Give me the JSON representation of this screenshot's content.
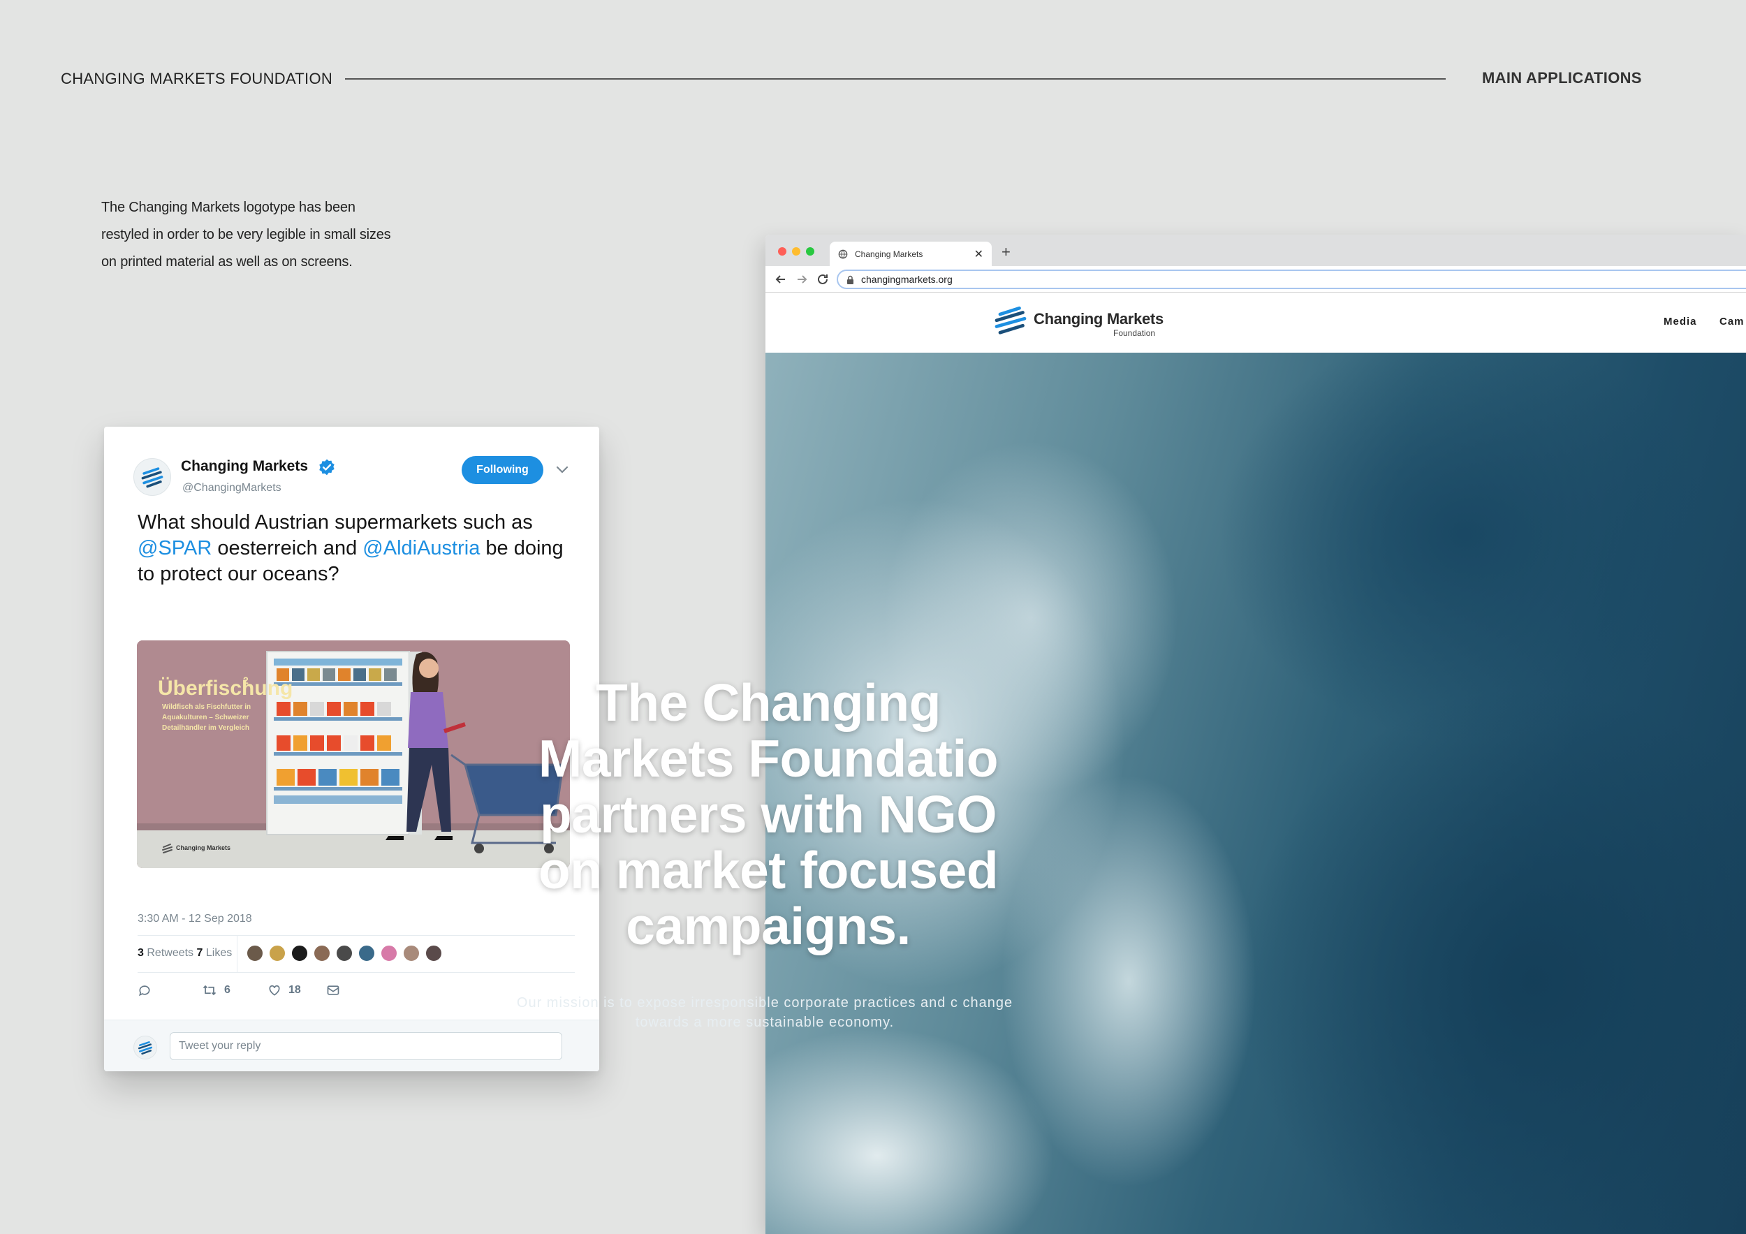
{
  "header": {
    "left_title": "CHANGING MARKETS FOUNDATION",
    "right_title": "MAIN APPLICATIONS"
  },
  "intro": {
    "text": "The Changing Markets logotype has been restyled in order to be very legible in small sizes on printed material as well as on screens."
  },
  "tweet": {
    "name": "Changing Markets",
    "handle": "@ChangingMarkets",
    "follow_label": "Following",
    "text_part1": "What should Austrian supermarkets such as ",
    "mention1": "@SPAR",
    "text_part2": " oesterreich and ",
    "mention2": "@AldiAustria",
    "text_part3": " be doing to protect our oceans?",
    "media": {
      "headline": "Überfischung",
      "superscript": "2",
      "sub": "Wildfisch als Fischfutter in Aquakulturen – Schweizer Detailhändler im Vergleich",
      "brand": "Changing Markets"
    },
    "timestamp": "3:30 AM - 12 Sep 2018",
    "retweets_count": "3",
    "retweets_label": "Retweets",
    "likes_count": "7",
    "likes_label": "Likes",
    "liker_colors": [
      "#6b5a4a",
      "#c9a24a",
      "#1b1b1b",
      "#8a6a55",
      "#4a4a4a",
      "#3a6a8a",
      "#d77aa8",
      "#a88a7a",
      "#5a4a4a"
    ],
    "action_retweets": "6",
    "action_likes": "18",
    "reply_placeholder": "Tweet your reply"
  },
  "browser": {
    "tab_title": "Changing Markets",
    "url": "changingmarkets.org",
    "site_brand": "Changing Markets",
    "site_brand_sub": "Foundation",
    "nav_media": "Media",
    "nav_cam": "Cam",
    "hero_title": "The Changing Markets Foundatio partners with NGO on market focused campaigns.",
    "hero_sub": "Our mission is to expose irresponsible corporate practices and c change towards a more sustainable economy."
  },
  "colors": {
    "background": "#e3e4e3",
    "twitter_blue": "#1d8fe1",
    "media_bg": "#b08a90"
  }
}
